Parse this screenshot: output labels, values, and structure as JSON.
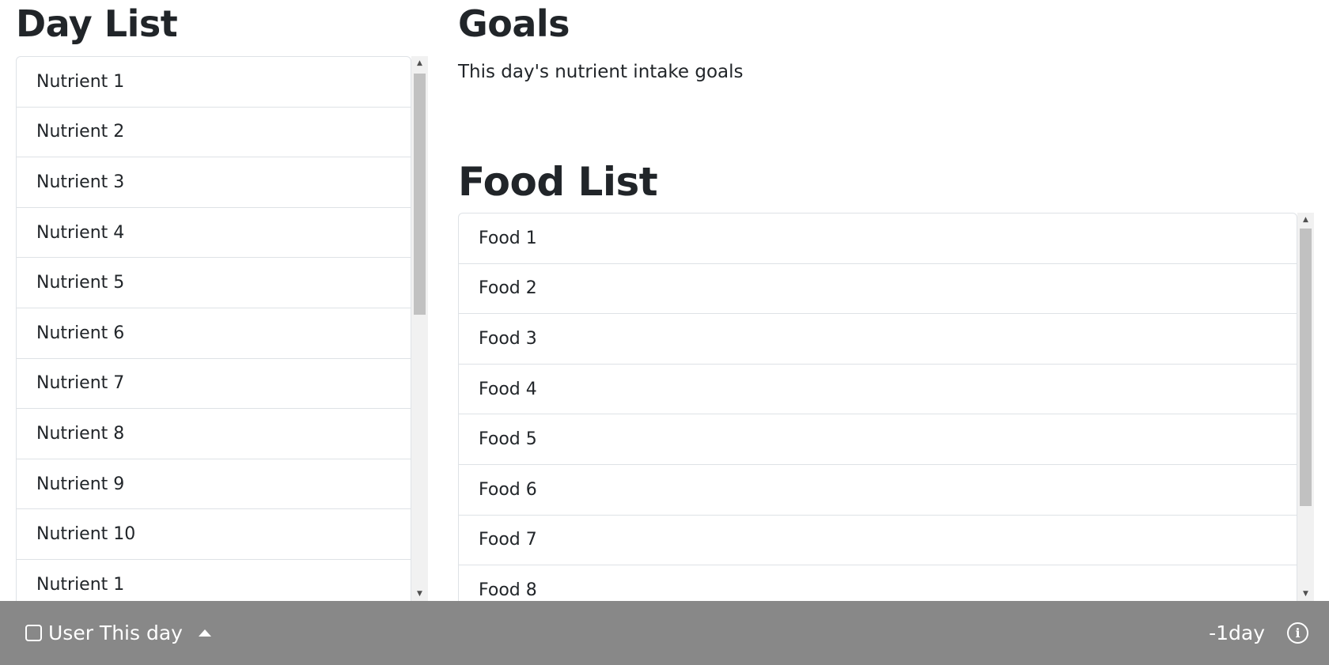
{
  "day_list": {
    "title": "Day List",
    "items": [
      "Nutrient 1",
      "Nutrient 2",
      "Nutrient 3",
      "Nutrient 4",
      "Nutrient 5",
      "Nutrient 6",
      "Nutrient 7",
      "Nutrient 8",
      "Nutrient 9",
      "Nutrient 10",
      "Nutrient 1"
    ]
  },
  "goals": {
    "title": "Goals",
    "description": "This day's nutrient intake goals"
  },
  "food_list": {
    "title": "Food List",
    "items": [
      "Food 1",
      "Food 2",
      "Food 3",
      "Food 4",
      "Food 5",
      "Food 6",
      "Food 7",
      "Food 8"
    ]
  },
  "bottom_bar": {
    "user_label": "User This day",
    "day_offset": "-1day",
    "info_icon": "info-icon",
    "background": "#888888"
  },
  "icons": {
    "scroll_up": "▲",
    "scroll_down": "▼",
    "info": "i"
  }
}
